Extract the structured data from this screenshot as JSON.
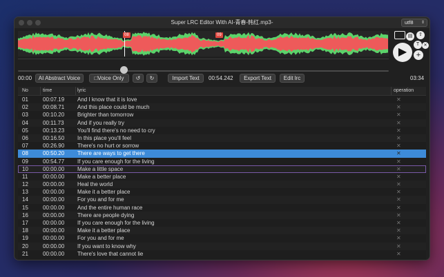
{
  "window": {
    "title": "Super LRC Editor With AI-青春-韩红.mp3-",
    "encoding": "utf8"
  },
  "waveform": {
    "colors": {
      "background": "#262626",
      "green": "#5bd36a",
      "red": "#ee5a5a",
      "cursor": "#ffffff"
    },
    "markers": [
      "08",
      "09"
    ]
  },
  "playback": {
    "start_time": "00:00",
    "end_time": "03:34",
    "current_time": "00:54.242",
    "progress": 0.285
  },
  "controls": {
    "ai_abstract_voice": "AI Abstract Voice",
    "voice_only": "□Voice Only",
    "rewind_icon": "↺",
    "forward_icon": "↻",
    "import_text": "Import Text",
    "export_text": "Export Text",
    "edit_lrc": "Edit lrc"
  },
  "tools": {
    "icons": [
      "window-icon",
      "save-icon",
      "import-icon",
      "translate-icon",
      "close-icon",
      "play-icon",
      "add-icon"
    ],
    "labels": {
      "translate": "T",
      "close": "✕",
      "play": "▶",
      "add": "+"
    }
  },
  "table": {
    "headers": {
      "no": "No",
      "time": "time",
      "lyric": "lyric",
      "operation": "operation"
    },
    "selected_row": 7,
    "boxed_row": 9,
    "delete_glyph": "✕",
    "rows": [
      {
        "no": "01",
        "time": "00:07.19",
        "lyric": "And I know that it is love"
      },
      {
        "no": "02",
        "time": "00:08.71",
        "lyric": "And this place could be much"
      },
      {
        "no": "03",
        "time": "00:10.20",
        "lyric": "Brighter than tomorrow"
      },
      {
        "no": "04",
        "time": "00:11.73",
        "lyric": "And if you really try"
      },
      {
        "no": "05",
        "time": "00:13.23",
        "lyric": "You'll find there's no need to cry"
      },
      {
        "no": "06",
        "time": "00:16.50",
        "lyric": "In this place you'll feel"
      },
      {
        "no": "07",
        "time": "00:26.90",
        "lyric": "There's no hurt or sorrow"
      },
      {
        "no": "08",
        "time": "00:50.20",
        "lyric": "There are ways to get there"
      },
      {
        "no": "09",
        "time": "00:54.77",
        "lyric": "If you care enough for the living"
      },
      {
        "no": "10",
        "time": "00:00.00",
        "lyric": "Make a little space"
      },
      {
        "no": "11",
        "time": "00:00.00",
        "lyric": "Make a better place"
      },
      {
        "no": "12",
        "time": "00:00.00",
        "lyric": "Heal the world"
      },
      {
        "no": "13",
        "time": "00:00.00",
        "lyric": "Make it a better place"
      },
      {
        "no": "14",
        "time": "00:00.00",
        "lyric": "For you and for me"
      },
      {
        "no": "15",
        "time": "00:00.00",
        "lyric": "And the entire human race"
      },
      {
        "no": "16",
        "time": "00:00.00",
        "lyric": "There are people dying"
      },
      {
        "no": "17",
        "time": "00:00.00",
        "lyric": "If you care enough for the living"
      },
      {
        "no": "18",
        "time": "00:00.00",
        "lyric": "Make it a better place"
      },
      {
        "no": "19",
        "time": "00:00.00",
        "lyric": "For you and for me"
      },
      {
        "no": "20",
        "time": "00:00.00",
        "lyric": "If you want to know why"
      },
      {
        "no": "21",
        "time": "00:00.00",
        "lyric": "There's love that cannot lie"
      }
    ]
  }
}
